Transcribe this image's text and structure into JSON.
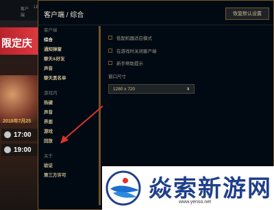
{
  "background": {
    "nav": [
      "客户端",
      "LPL"
    ],
    "banner_text": "限定庆",
    "date": "2018年7月25",
    "matches": [
      "17:00",
      "19:00"
    ]
  },
  "header": {
    "title": "客户端 / 综合",
    "restore_button": "恢复默认设置"
  },
  "sidebar": [
    {
      "type": "section",
      "label": "客户端"
    },
    {
      "type": "item",
      "label": "综合",
      "active": true
    },
    {
      "type": "item",
      "label": "通知弹窗"
    },
    {
      "type": "item",
      "label": "聊天&好友"
    },
    {
      "type": "item",
      "label": "声音"
    },
    {
      "type": "item",
      "label": "聊天黑名单"
    },
    {
      "type": "spacer"
    },
    {
      "type": "section",
      "label": "游戏内"
    },
    {
      "type": "item",
      "label": "热键"
    },
    {
      "type": "item",
      "label": "声音"
    },
    {
      "type": "item",
      "label": "界面"
    },
    {
      "type": "item",
      "label": "游戏"
    },
    {
      "type": "item",
      "label": "回放"
    },
    {
      "type": "spacer"
    },
    {
      "type": "section",
      "label": "关于"
    },
    {
      "type": "item",
      "label": "验证"
    },
    {
      "type": "item",
      "label": "第三方许可"
    }
  ],
  "content": {
    "checkboxes": [
      {
        "label": "低配机器适应模式",
        "checked": false
      },
      {
        "label": "在游戏时关闭客户端",
        "checked": false
      },
      {
        "label": "新手帮助提示",
        "checked": false
      }
    ],
    "window_size_label": "窗口尺寸",
    "window_size_value": "1280 x 720"
  },
  "watermark": {
    "name": "焱索新游网",
    "url": "www.yenso.net"
  },
  "colors": {
    "gold": "#785a28",
    "text_gold": "#cdbe91",
    "arrow": "#e0322c"
  }
}
